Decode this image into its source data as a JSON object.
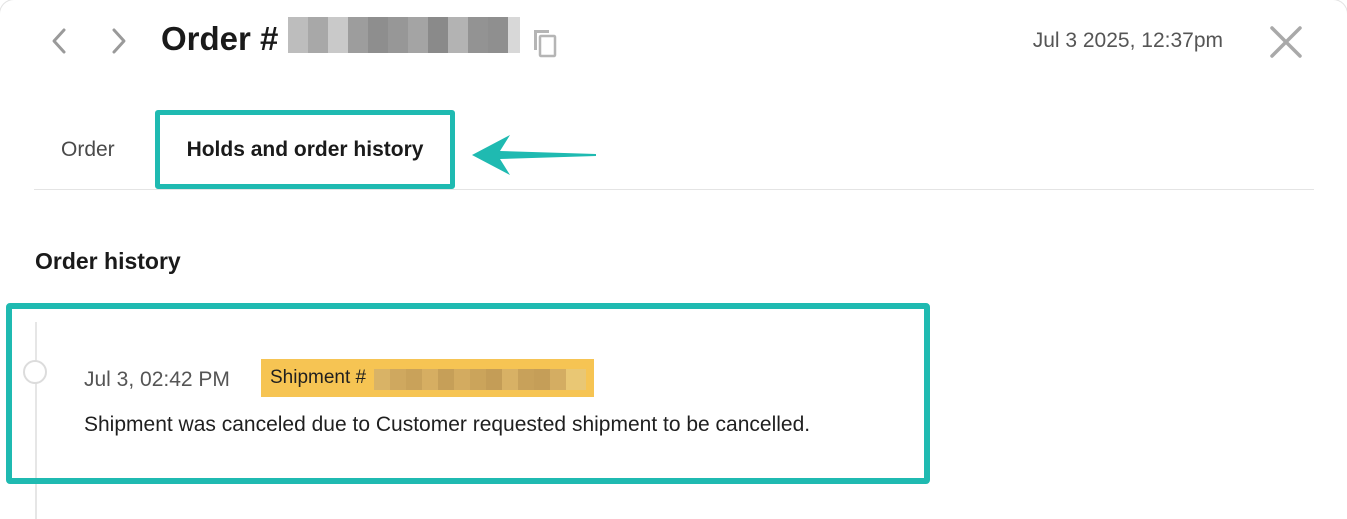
{
  "header": {
    "title_prefix": "Order #",
    "date": "Jul 3 2025, 12:37pm",
    "prev_icon": "chevron-left-icon",
    "next_icon": "chevron-right-icon",
    "copy_icon": "copy-icon",
    "close_icon": "close-icon"
  },
  "tabs": [
    {
      "label": "Order",
      "active": false
    },
    {
      "label": "Holds and order history",
      "active": true
    }
  ],
  "section": {
    "title": "Order history"
  },
  "history": [
    {
      "time": "Jul 3, 02:42 PM",
      "tag_prefix": "Shipment #",
      "description": "Shipment was canceled due to Customer requested shipment to be cancelled."
    }
  ],
  "colors": {
    "annotation": "#1fbab1",
    "shipment_tag": "#f6c453",
    "divider": "#e4e4e4",
    "text_primary": "#1a1a1a",
    "text_secondary": "#555555"
  }
}
